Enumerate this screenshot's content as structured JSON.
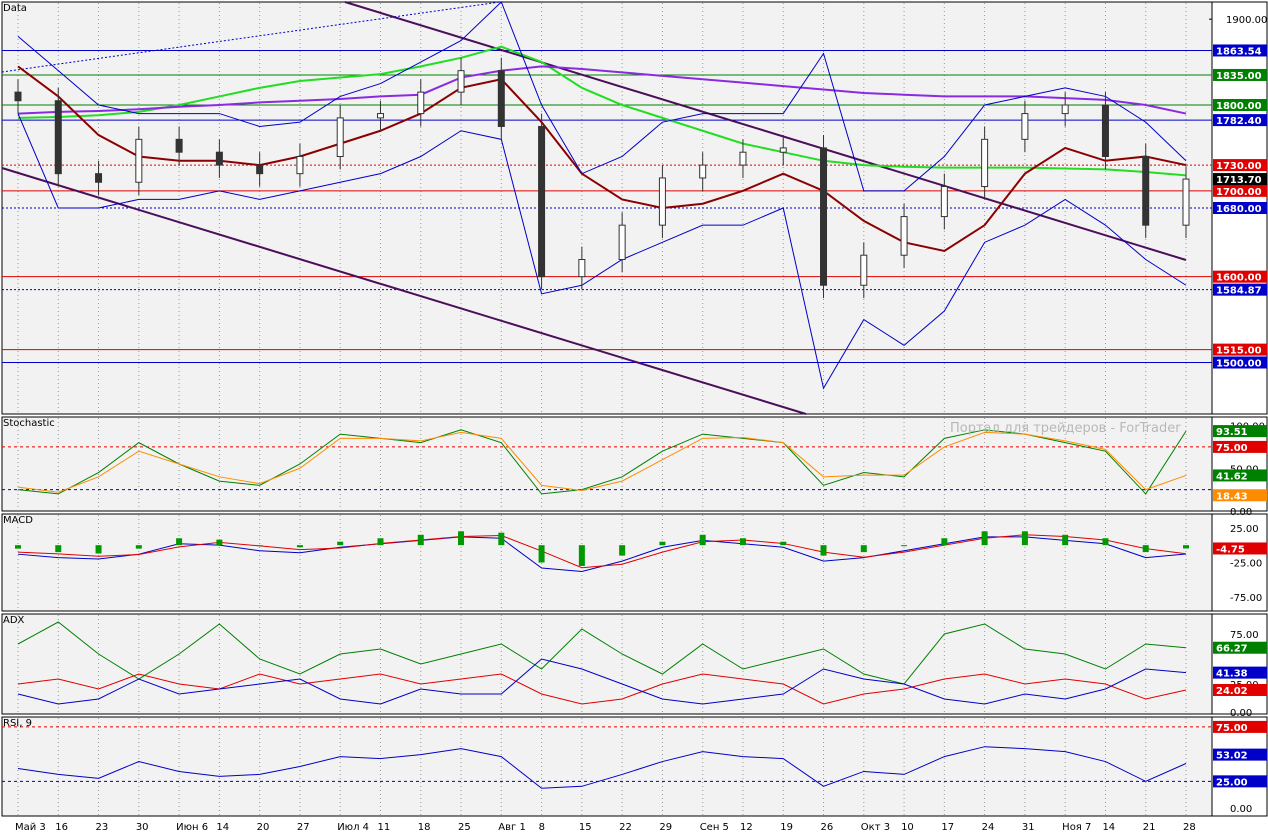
{
  "colors": {
    "bg": "#f2f2f2",
    "grid": "#9a9a9a",
    "blue_line": "#0000c8",
    "red_line": "#e00000",
    "green_line": "#008000",
    "ma_green": "#22dd22",
    "ma_purple": "#8a2be2",
    "ma_darkred": "#8b0000",
    "channel": "#4b0f5a",
    "candle_dark": "#333333"
  },
  "x_dates": [
    "Май 3",
    "16",
    "23",
    "30",
    "Июн 6",
    "14",
    "20",
    "27",
    "Июл 4",
    "11",
    "18",
    "25",
    "Авг 1",
    "8",
    "15",
    "22",
    "29",
    "Сен 5",
    "12",
    "19",
    "26",
    "Окт 3",
    "10",
    "17",
    "24",
    "31",
    "Ноя 7",
    "14",
    "21",
    "28"
  ],
  "watermark": "Портал для трейдеров - ForTrader",
  "price_panel": {
    "title": "Data",
    "current_price": "1713.70",
    "levels": [
      {
        "label": "1863.54",
        "value": 1863.54,
        "color": "blue"
      },
      {
        "label": "1835.00",
        "value": 1835,
        "color": "green"
      },
      {
        "label": "1800.00",
        "value": 1800,
        "color": "green"
      },
      {
        "label": "1782.40",
        "value": 1782.4,
        "color": "blue"
      },
      {
        "label": "1730.00",
        "value": 1730,
        "color": "red_dotted"
      },
      {
        "label": "1700.00",
        "value": 1700,
        "color": "red"
      },
      {
        "label": "1680.00",
        "value": 1680,
        "color": "blue_dotted"
      },
      {
        "label": "1600.00",
        "value": 1600,
        "color": "red"
      },
      {
        "label": "1584.87",
        "value": 1584.87,
        "color": "blue_dotted"
      },
      {
        "label": "1515.00",
        "value": 1515,
        "color": "red"
      },
      {
        "label": "1500.00",
        "value": 1500,
        "color": "blue"
      }
    ],
    "scale_label": "1900.00"
  },
  "stochastic_panel": {
    "title": "Stochastic",
    "scale_labels": [
      "100.00",
      "50.00",
      "0.00"
    ],
    "level_labels": [
      "75.00"
    ],
    "value_labels": [
      "93.51",
      "41.62",
      "18.43"
    ]
  },
  "macd_panel": {
    "title": "MACD",
    "scale_labels": [
      "25.00",
      "-25.00",
      "-75.00"
    ],
    "value_labels": [
      "-4.75"
    ]
  },
  "adx_panel": {
    "title": "ADX",
    "scale_labels": [
      "75.00",
      "25.00",
      "0.00"
    ],
    "value_labels": [
      "66.27",
      "41.38",
      "24.02"
    ]
  },
  "rsi_panel": {
    "title": "RSI, 9",
    "scale_labels": [
      "75.00",
      "25.00",
      "0.00"
    ],
    "value_labels": [
      "53.02"
    ]
  },
  "chart_data": [
    {
      "type": "candlestick",
      "title": "Data",
      "ylim": [
        1440,
        1920
      ],
      "x": [
        "Май 3",
        "16",
        "23",
        "30",
        "Июн 6",
        "14",
        "20",
        "27",
        "Июл 4",
        "11",
        "18",
        "25",
        "Авг 1",
        "8",
        "15",
        "22",
        "29",
        "Сен 5",
        "12",
        "19",
        "26",
        "Окт 3",
        "10",
        "17",
        "24",
        "31",
        "Ноя 7",
        "14",
        "21",
        "28"
      ],
      "close": [
        1805,
        1720,
        1710,
        1760,
        1745,
        1730,
        1720,
        1740,
        1785,
        1790,
        1815,
        1840,
        1775,
        1600,
        1620,
        1660,
        1715,
        1730,
        1745,
        1750,
        1590,
        1625,
        1670,
        1705,
        1760,
        1790,
        1800,
        1740,
        1660,
        1713.7
      ],
      "series": [
        {
          "name": "ma200",
          "values": [
            1785,
            1786,
            1788,
            1792,
            1800,
            1810,
            1820,
            1828,
            1832,
            1836,
            1845,
            1855,
            1868,
            1850,
            1820,
            1800,
            1785,
            1770,
            1755,
            1745,
            1735,
            1730,
            1728,
            1727,
            1727,
            1727,
            1726,
            1725,
            1722,
            1718
          ]
        },
        {
          "name": "ma100",
          "values": [
            1790,
            1792,
            1793,
            1795,
            1798,
            1800,
            1803,
            1805,
            1807,
            1810,
            1812,
            1832,
            1840,
            1845,
            1842,
            1838,
            1834,
            1830,
            1826,
            1822,
            1818,
            1814,
            1812,
            1810,
            1810,
            1810,
            1808,
            1806,
            1800,
            1790
          ]
        },
        {
          "name": "ma20",
          "values": [
            1845,
            1810,
            1765,
            1740,
            1735,
            1735,
            1730,
            1740,
            1755,
            1770,
            1790,
            1820,
            1830,
            1780,
            1720,
            1690,
            1680,
            1685,
            1700,
            1720,
            1700,
            1665,
            1640,
            1630,
            1660,
            1720,
            1750,
            1735,
            1740,
            1730
          ]
        },
        {
          "name": "bb_upper",
          "values": [
            1880,
            1840,
            1800,
            1790,
            1790,
            1790,
            1775,
            1780,
            1810,
            1825,
            1850,
            1875,
            1920,
            1800,
            1720,
            1740,
            1780,
            1790,
            1790,
            1790,
            1860,
            1700,
            1700,
            1740,
            1800,
            1810,
            1820,
            1810,
            1780,
            1735
          ]
        },
        {
          "name": "bb_lower",
          "values": [
            1790,
            1680,
            1680,
            1690,
            1690,
            1700,
            1690,
            1700,
            1710,
            1720,
            1740,
            1770,
            1760,
            1580,
            1590,
            1620,
            1640,
            1660,
            1660,
            1680,
            1470,
            1550,
            1520,
            1560,
            1640,
            1660,
            1690,
            1660,
            1620,
            1590
          ]
        }
      ]
    },
    {
      "type": "line",
      "title": "Stochastic",
      "ylim": [
        0,
        110
      ],
      "series": [
        {
          "name": "k",
          "values": [
            25,
            20,
            45,
            80,
            55,
            35,
            30,
            55,
            90,
            85,
            80,
            95,
            80,
            20,
            25,
            40,
            70,
            90,
            85,
            80,
            30,
            45,
            40,
            85,
            95,
            90,
            80,
            70,
            20,
            93.51
          ]
        },
        {
          "name": "d",
          "values": [
            28,
            22,
            40,
            70,
            55,
            40,
            32,
            50,
            85,
            85,
            82,
            92,
            85,
            30,
            24,
            35,
            60,
            85,
            86,
            80,
            40,
            42,
            42,
            75,
            92,
            90,
            82,
            72,
            25,
            41.62
          ]
        }
      ]
    },
    {
      "type": "bar",
      "title": "MACD",
      "ylim": [
        -95,
        45
      ],
      "values": [
        -5,
        -10,
        -12,
        -5,
        10,
        8,
        0,
        -3,
        5,
        10,
        15,
        20,
        18,
        -25,
        -30,
        -15,
        5,
        15,
        10,
        5,
        -15,
        -10,
        0,
        10,
        20,
        20,
        15,
        10,
        -10,
        -4.75
      ]
    },
    {
      "type": "line",
      "title": "ADX",
      "ylim": [
        0,
        100
      ],
      "series": [
        {
          "name": "adx",
          "values": [
            70,
            92,
            60,
            35,
            60,
            90,
            55,
            40,
            60,
            65,
            50,
            60,
            70,
            45,
            85,
            60,
            40,
            70,
            45,
            55,
            65,
            40,
            30,
            80,
            90,
            65,
            60,
            45,
            70,
            66.27
          ]
        },
        {
          "name": "dip",
          "values": [
            30,
            35,
            25,
            40,
            30,
            25,
            40,
            30,
            35,
            40,
            30,
            35,
            40,
            20,
            10,
            15,
            30,
            40,
            35,
            30,
            10,
            20,
            25,
            35,
            40,
            30,
            35,
            30,
            15,
            24.02
          ]
        },
        {
          "name": "dim",
          "values": [
            20,
            10,
            15,
            35,
            20,
            25,
            30,
            35,
            15,
            10,
            25,
            20,
            20,
            55,
            45,
            30,
            15,
            10,
            15,
            20,
            45,
            35,
            30,
            15,
            10,
            20,
            15,
            25,
            45,
            41.38
          ]
        }
      ]
    },
    {
      "type": "line",
      "title": "RSI, 9",
      "ylim": [
        0,
        100
      ],
      "values": [
        48,
        42,
        38,
        55,
        45,
        40,
        42,
        50,
        60,
        58,
        62,
        68,
        60,
        28,
        30,
        42,
        55,
        65,
        60,
        58,
        30,
        45,
        42,
        60,
        70,
        68,
        65,
        55,
        35,
        53.02
      ]
    }
  ]
}
